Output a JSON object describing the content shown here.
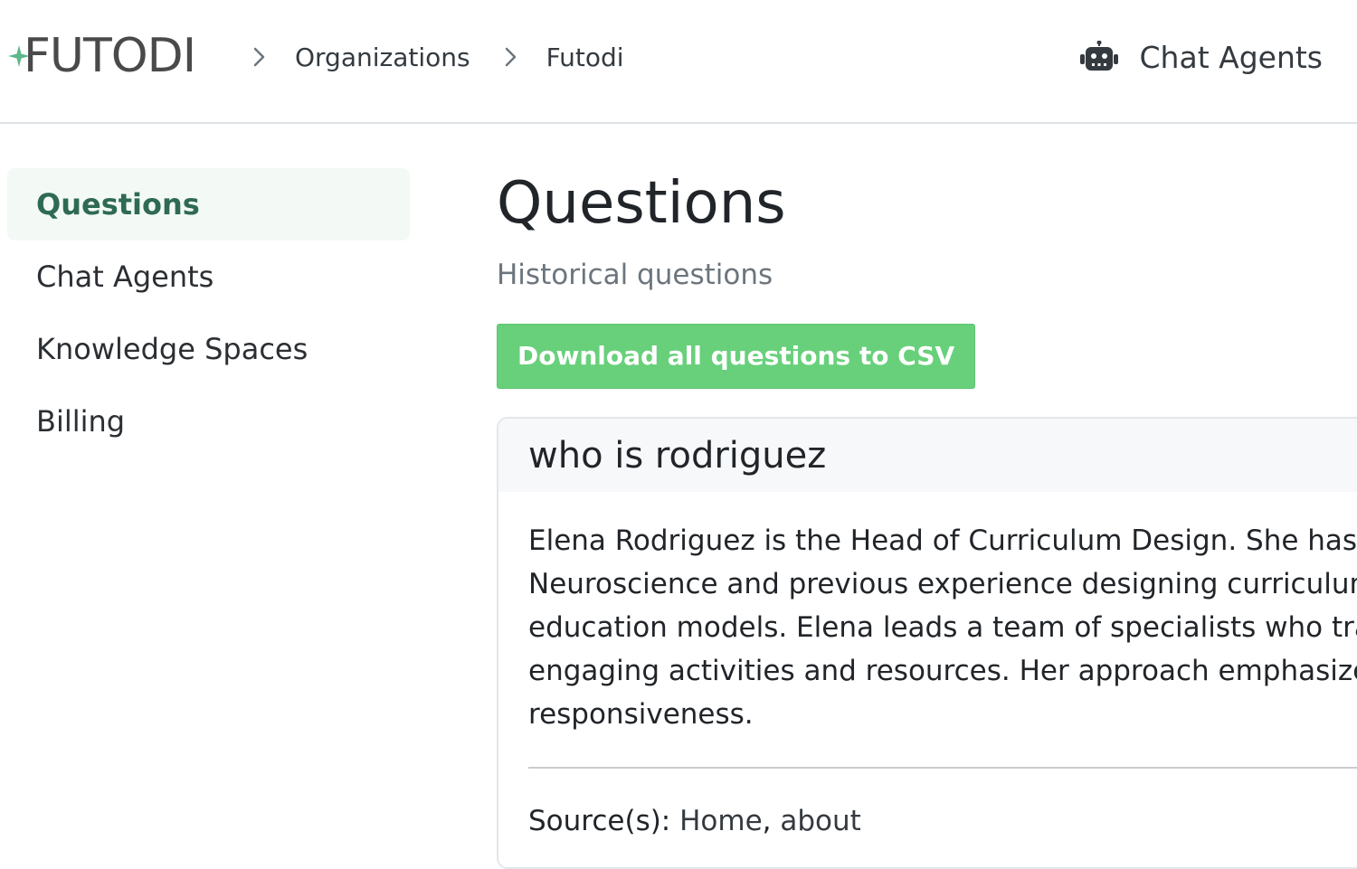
{
  "header": {
    "logo_text": "FUTODI",
    "breadcrumbs": [
      {
        "label": "Organizations"
      },
      {
        "label": "Futodi"
      }
    ],
    "chat_agents_label": "Chat Agents"
  },
  "sidebar": {
    "items": [
      {
        "label": "Questions",
        "active": true
      },
      {
        "label": "Chat Agents",
        "active": false
      },
      {
        "label": "Knowledge Spaces",
        "active": false
      },
      {
        "label": "Billing",
        "active": false
      }
    ]
  },
  "main": {
    "title": "Questions",
    "subtitle": "Historical questions",
    "download_button_label": "Download all questions to CSV",
    "questions": [
      {
        "question": "who is rodriguez",
        "answer_lines": [
          "Elena Rodriguez is the Head of Curriculum Design. She has a r",
          "Neuroscience and previous experience designing curriculum f",
          "education models. Elena leads a team of specialists who trans",
          "engaging activities and resources. Her approach emphasizes p",
          "responsiveness."
        ],
        "sources_label": "Source(s):",
        "sources": [
          "Home",
          "about"
        ]
      }
    ]
  },
  "colors": {
    "accent_green": "#68d07b",
    "active_nav_text": "#2f6a55",
    "active_nav_bg": "#f3faf6",
    "logo_spark": "#5cb88a"
  },
  "icons": {
    "logo": "sparkle-icon",
    "breadcrumb_separator": "chevron-right-icon",
    "chat_agents": "robot-icon"
  }
}
